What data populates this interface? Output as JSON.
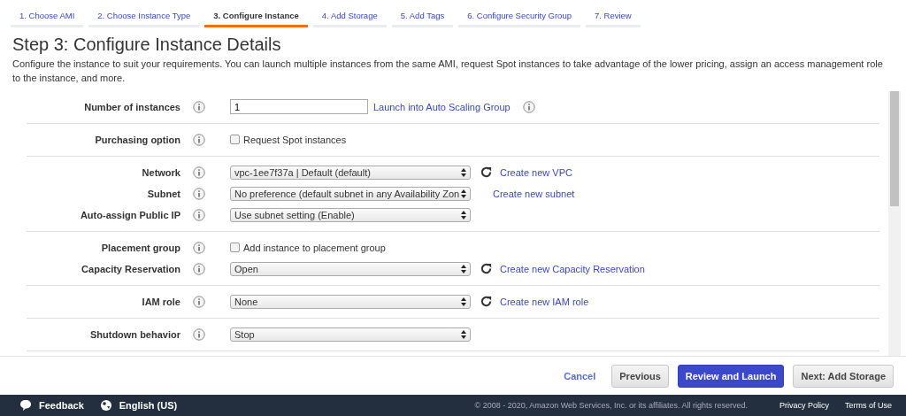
{
  "tabs": [
    {
      "label": "1. Choose AMI",
      "selected": false
    },
    {
      "label": "2. Choose Instance Type",
      "selected": false
    },
    {
      "label": "3. Configure Instance",
      "selected": true
    },
    {
      "label": "4. Add Storage",
      "selected": false
    },
    {
      "label": "5. Add Tags",
      "selected": false
    },
    {
      "label": "6. Configure Security Group",
      "selected": false
    },
    {
      "label": "7. Review",
      "selected": false
    }
  ],
  "title": "Step 3: Configure Instance Details",
  "description": "Configure the instance to suit your requirements. You can launch multiple instances from the same AMI, request Spot instances to take advantage of the lower pricing, assign an access management role to the instance, and more.",
  "groups": [
    {
      "rows": [
        {
          "label": "Number of instances",
          "kind": "input",
          "value": "1",
          "link": "Launch into Auto Scaling Group",
          "link_info": true
        }
      ]
    },
    {
      "rows": [
        {
          "label": "Purchasing option",
          "kind": "checkbox",
          "text": "Request Spot instances",
          "checked": false
        }
      ]
    },
    {
      "rows": [
        {
          "label": "Network",
          "kind": "select",
          "value": "vpc-1ee7f37a | Default (default)",
          "refresh": true,
          "link": "Create new VPC"
        },
        {
          "label": "Subnet",
          "kind": "select",
          "value": "No preference (default subnet in any Availability Zon",
          "refresh": false,
          "link": "Create new subnet"
        },
        {
          "label": "Auto-assign Public IP",
          "kind": "select",
          "value": "Use subnet setting (Enable)"
        }
      ]
    },
    {
      "rows": [
        {
          "label": "Placement group",
          "kind": "checkbox",
          "text": "Add instance to placement group",
          "checked": false
        },
        {
          "label": "Capacity Reservation",
          "kind": "select",
          "value": "Open",
          "refresh": true,
          "link": "Create new Capacity Reservation"
        }
      ]
    },
    {
      "rows": [
        {
          "label": "IAM role",
          "kind": "select",
          "value": "None",
          "refresh": true,
          "link": "Create new IAM role"
        }
      ]
    },
    {
      "rows": [
        {
          "label": "Shutdown behavior",
          "kind": "select",
          "value": "Stop"
        }
      ]
    }
  ],
  "actions": {
    "cancel": "Cancel",
    "previous": "Previous",
    "primary": "Review and Launch",
    "next": "Next: Add Storage"
  },
  "footer": {
    "feedback": "Feedback",
    "language": "English (US)",
    "copyright": "© 2008 - 2020, Amazon Web Services, Inc. or its affiliates. All rights reserved.",
    "links": [
      "Privacy Policy",
      "Terms of Use"
    ]
  }
}
